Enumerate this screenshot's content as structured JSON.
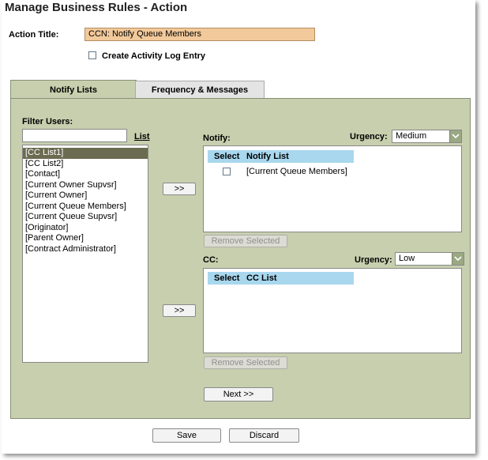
{
  "page_title": "Manage Business Rules - Action",
  "action_title": {
    "label": "Action Title:",
    "value": "CCN: Notify Queue Members"
  },
  "activity_log": {
    "label": "Create Activity Log Entry",
    "checked": false
  },
  "tabs": [
    {
      "label": "Notify Lists",
      "active": true
    },
    {
      "label": "Frequency & Messages",
      "active": false
    }
  ],
  "filter": {
    "label": "Filter Users:",
    "value": "",
    "list_link": "List"
  },
  "users": [
    "[CC List1]",
    "[CC List2]",
    "[Contact]",
    "[Current Owner Supvsr]",
    "[Current Owner]",
    "[Current Queue Members]",
    "[Current Queue Supvsr]",
    "[Originator]",
    "[Parent Owner]",
    "[Contract Administrator]"
  ],
  "selected_user": "[CC List1]",
  "notify": {
    "label": "Notify:",
    "urgency_label": "Urgency:",
    "urgency_value": "Medium",
    "add_button": ">>",
    "col_select": "Select",
    "col_list": "Notify List",
    "rows": [
      "[Current Queue Members]"
    ],
    "remove_button": "Remove Selected"
  },
  "cc": {
    "label": "CC:",
    "urgency_label": "Urgency:",
    "urgency_value": "Low",
    "add_button": ">>",
    "col_select": "Select",
    "col_list": "CC List",
    "rows": [],
    "remove_button": "Remove Selected"
  },
  "next_button": "Next >>",
  "footer": {
    "save": "Save",
    "discard": "Discard"
  },
  "colors": {
    "panel": "#c7cfae",
    "title_field": "#f2c99a",
    "table_header": "#a8d7ee",
    "selected_item": "#6b6b51"
  }
}
